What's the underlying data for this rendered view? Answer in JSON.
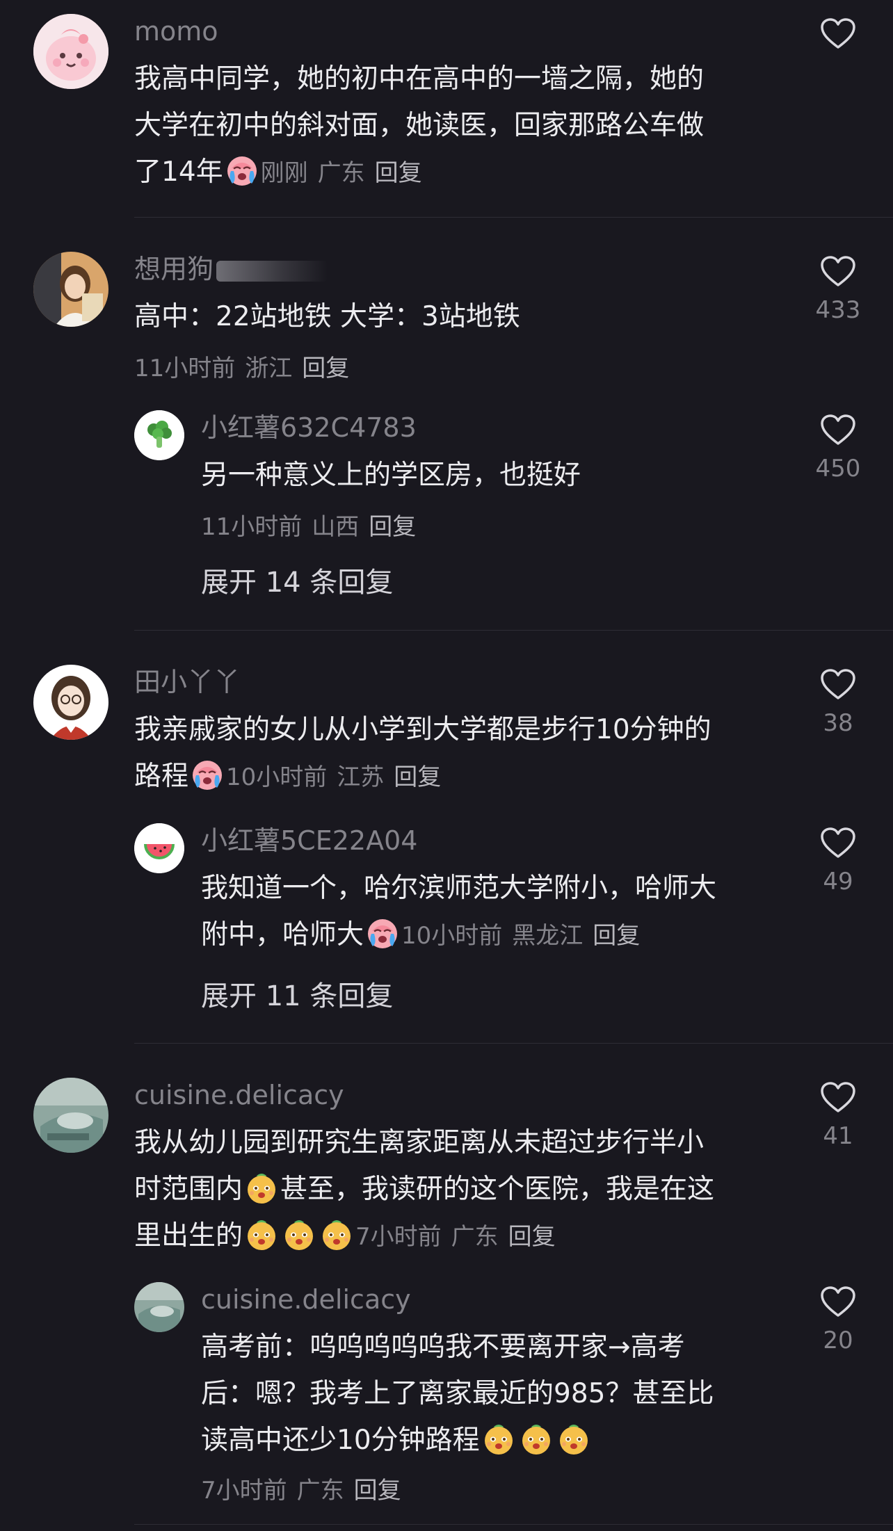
{
  "comments": [
    {
      "username": "momo",
      "text_lines": [
        "我高中同学，她的初中在高中的一墙之隔，她的",
        "大学在初中的斜对面，她读医，回家那路公车做",
        "了14年"
      ],
      "time": "刚刚",
      "location": "广东",
      "reply_label": "回复",
      "likes": "",
      "emoji": "crying-face"
    },
    {
      "username": "想用狗",
      "text_lines": [
        "高中：22站地铁 大学：3站地铁"
      ],
      "time": "11小时前",
      "location": "浙江",
      "reply_label": "回复",
      "likes": "433",
      "reply": {
        "username": "小红薯632C4783",
        "text_lines": [
          "另一种意义上的学区房，也挺好"
        ],
        "time": "11小时前",
        "location": "山西",
        "reply_label": "回复",
        "likes": "450"
      },
      "expand_label": "展开 14 条回复"
    },
    {
      "username": "田小丫丫",
      "text_lines": [
        "我亲戚家的女儿从小学到大学都是步行10分钟的",
        "路程"
      ],
      "time": "10小时前",
      "location": "江苏",
      "reply_label": "回复",
      "likes": "38",
      "emoji": "crying-face",
      "reply": {
        "username": "小红薯5CE22A04",
        "text_lines": [
          "我知道一个，哈尔滨师范大学附小，哈师大",
          "附中，哈师大"
        ],
        "time": "10小时前",
        "location": "黑龙江",
        "reply_label": "回复",
        "likes": "49",
        "emoji": "crying-face"
      },
      "expand_label": "展开 11 条回复"
    },
    {
      "username": "cuisine.delicacy",
      "text_lines": [
        "我从幼儿园到研究生离家距离从未超过步行半小",
        "时范围内",
        "甚至，我读研的这个医院，我是在这",
        "里出生的"
      ],
      "time": "7小时前",
      "location": "广东",
      "reply_label": "回复",
      "likes": "41",
      "emoji": "laughing-face",
      "reply": {
        "username": "cuisine.delicacy",
        "text_lines": [
          "高考前：呜呜呜呜呜我不要离开家→高考",
          "后：嗯？我考上了离家最近的985？甚至比",
          "读高中还少10分钟路程"
        ],
        "time": "7小时前",
        "location": "广东",
        "reply_label": "回复",
        "likes": "20",
        "emoji": "laughing-face"
      }
    }
  ],
  "colors": {
    "background": "#19181f",
    "text_primary": "#ececef",
    "text_secondary": "#85848b"
  },
  "icons": [
    "heart-outline-icon",
    "crying-face-emoji",
    "laughing-face-emoji"
  ]
}
